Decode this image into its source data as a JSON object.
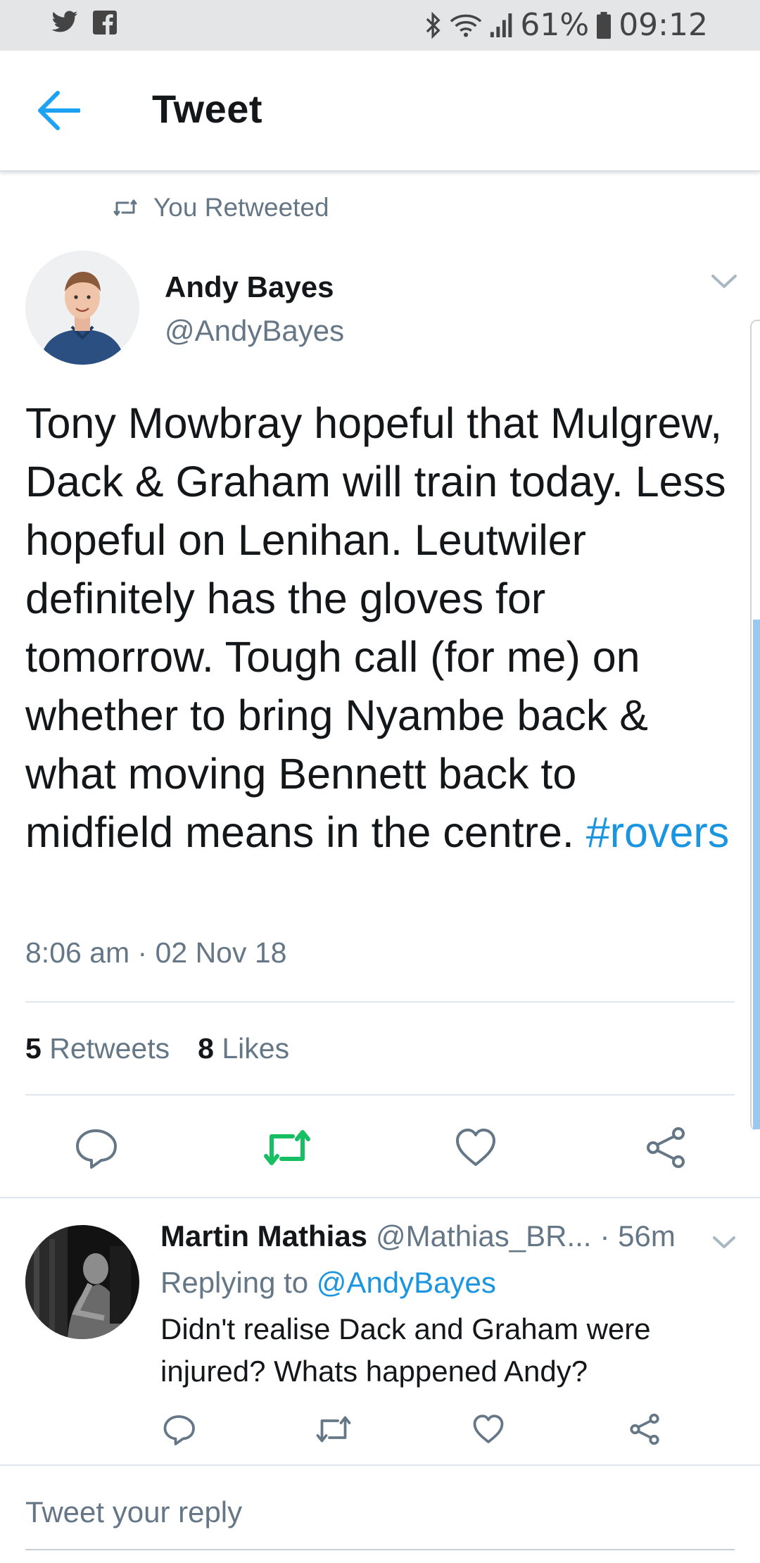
{
  "status_bar": {
    "battery": "61%",
    "time": "09:12",
    "icons": [
      "twitter-icon",
      "facebook-icon",
      "bluetooth-icon",
      "wifi-icon",
      "signal-icon",
      "battery-icon"
    ]
  },
  "header": {
    "title": "Tweet",
    "back_icon": "arrow-left-icon"
  },
  "retweet_label": "You Retweeted",
  "tweet": {
    "author_name": "Andy Bayes",
    "author_handle": "@AndyBayes",
    "text": "Tony Mowbray hopeful that Mulgrew, Dack & Graham will train today. Less hopeful on Lenihan. Leutwiler definitely has the gloves for tomorrow. Tough call (for me) on whether to bring Nyambe back & what moving Bennett back to midfield means in the centre. ",
    "hashtag": "#rovers",
    "timestamp": "8:06 am · 02 Nov 18",
    "retweets_count": "5",
    "retweets_label": "Retweets",
    "likes_count": "8",
    "likes_label": "Likes"
  },
  "reply": {
    "author_name": "Martin Mathias",
    "author_handle": "@Mathias_BR...",
    "time": "· 56m",
    "replying_prefix": "Replying to",
    "replying_to": "@AndyBayes",
    "text": "Didn't realise Dack and Graham were injured? Whats happened Andy?"
  },
  "composer": {
    "placeholder": "Tweet your reply"
  },
  "colors": {
    "accent": "#1b95e0",
    "retweet_active": "#17bf63",
    "muted": "#657786"
  }
}
